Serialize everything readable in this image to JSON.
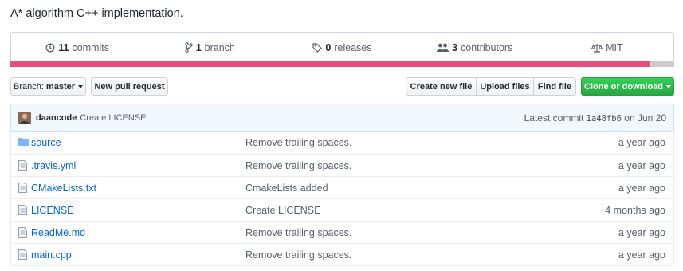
{
  "repo": {
    "description": "A* algorithm C++ implementation."
  },
  "summary": {
    "commits": {
      "count": "11",
      "label": "commits"
    },
    "branches": {
      "count": "1",
      "label": "branch"
    },
    "releases": {
      "count": "0",
      "label": "releases"
    },
    "contributors": {
      "count": "3",
      "label": "contributors"
    },
    "license": "MIT",
    "language_bar": {
      "primary_color": "#e64e7e",
      "secondary_color": "#cccccc",
      "primary_fraction": 0.964
    }
  },
  "toolbar": {
    "branch_prefix": "Branch:",
    "branch_name": "master",
    "new_pull_request": "New pull request",
    "create_new_file": "Create new file",
    "upload_files": "Upload files",
    "find_file": "Find file",
    "clone_or_download": "Clone or download"
  },
  "latest_commit": {
    "author": "daancode",
    "message": "Create LICENSE",
    "prefix": "Latest commit",
    "sha": "1a48fb6",
    "date": "on Jun 20"
  },
  "files": [
    {
      "type": "folder",
      "icon": "folder-icon",
      "name": "source",
      "message": "Remove trailing spaces.",
      "age": "a year ago"
    },
    {
      "type": "file",
      "icon": "file-icon",
      "name": ".travis.yml",
      "message": "Remove trailing spaces.",
      "age": "a year ago"
    },
    {
      "type": "file",
      "icon": "file-icon",
      "name": "CMakeLists.txt",
      "message": "CmakeLists added",
      "age": "a year ago"
    },
    {
      "type": "file",
      "icon": "file-icon",
      "name": "LICENSE",
      "message": "Create LICENSE",
      "age": "4 months ago"
    },
    {
      "type": "file",
      "icon": "file-icon",
      "name": "ReadMe.md",
      "message": "Remove trailing spaces.",
      "age": "a year ago"
    },
    {
      "type": "file",
      "icon": "file-icon",
      "name": "main.cpp",
      "message": "Remove trailing spaces.",
      "age": "a year ago"
    }
  ]
}
